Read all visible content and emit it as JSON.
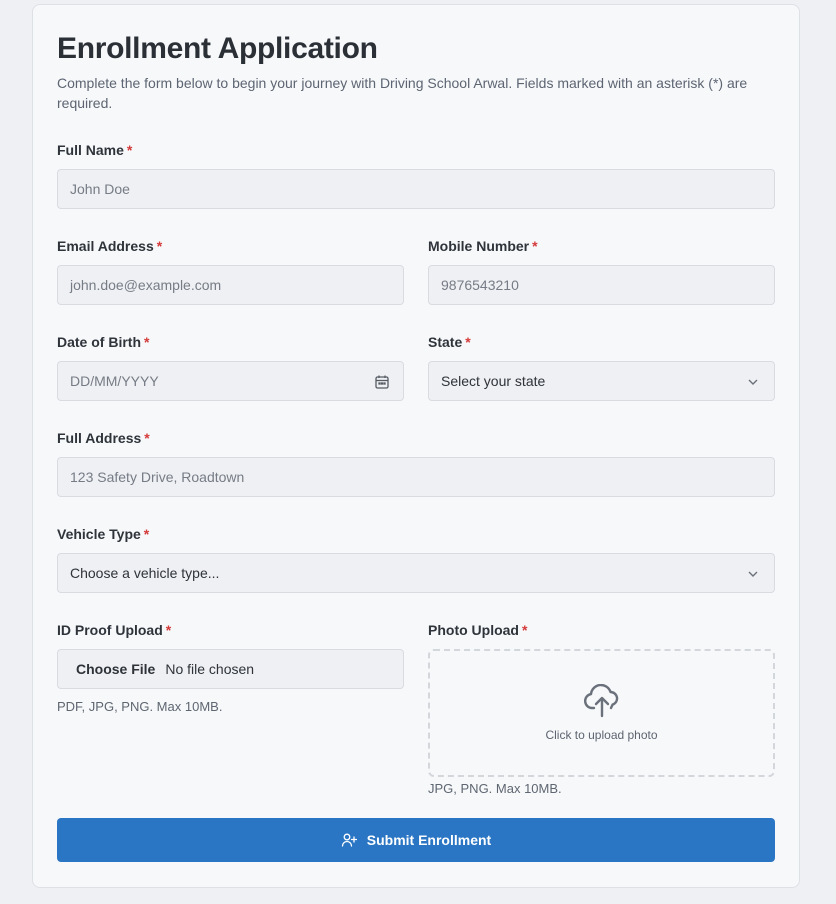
{
  "form": {
    "title": "Enrollment Application",
    "subtitle": "Complete the form below to begin your journey with Driving School Arwal. Fields marked with an asterisk (*) are required.",
    "required_mark": "*",
    "full_name": {
      "label": "Full Name",
      "placeholder": "John Doe"
    },
    "email": {
      "label": "Email Address",
      "placeholder": "john.doe@example.com"
    },
    "mobile": {
      "label": "Mobile Number",
      "placeholder": "9876543210"
    },
    "dob": {
      "label": "Date of Birth",
      "placeholder": "DD/MM/YYYY",
      "icon": "calendar-icon"
    },
    "state": {
      "label": "State",
      "selected": "Select your state",
      "icon": "chevron-down-icon"
    },
    "address": {
      "label": "Full Address",
      "placeholder": "123 Safety Drive, Roadtown"
    },
    "vehicle_type": {
      "label": "Vehicle Type",
      "selected": "Choose a vehicle type...",
      "icon": "chevron-down-icon"
    },
    "id_proof": {
      "label": "ID Proof Upload",
      "button": "Choose File",
      "status": "No file chosen",
      "hint": "PDF, JPG, PNG. Max 10MB."
    },
    "photo": {
      "label": "Photo Upload",
      "dropzone_text": "Click to upload photo",
      "icon": "cloud-upload-icon",
      "hint": "JPG, PNG. Max 10MB."
    },
    "submit": {
      "label": "Submit Enrollment",
      "icon": "user-plus-icon"
    }
  },
  "colors": {
    "accent": "#2b76c4",
    "required": "#d43a3a",
    "page_bg": "#eef0f4",
    "card_bg": "#f7f8fa",
    "input_bg": "#eff0f3"
  }
}
